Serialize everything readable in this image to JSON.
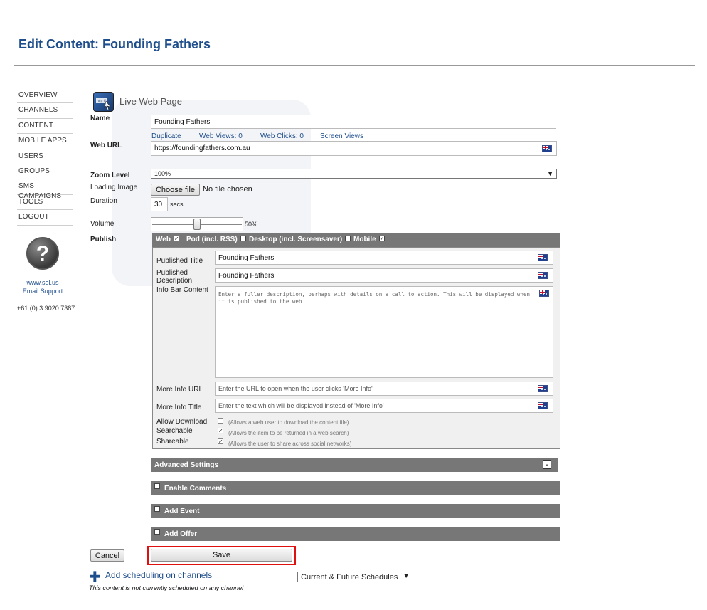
{
  "page": {
    "title": "Edit Content: Founding Fathers"
  },
  "sidebar": {
    "items": [
      {
        "label": "OVERVIEW"
      },
      {
        "label": "CHANNELS"
      },
      {
        "label": "CONTENT"
      },
      {
        "label": "MOBILE APPS"
      },
      {
        "label": "USERS"
      },
      {
        "label": "GROUPS"
      },
      {
        "label": "SMS CAMPAIGNS"
      },
      {
        "label": "TOOLS"
      },
      {
        "label": "LOGOUT"
      }
    ],
    "help_symbol": "?",
    "website": "www.sol.us",
    "email_support": "Email Support",
    "phone": "+61 (0) 3 9020 7387"
  },
  "content_type": {
    "label": "Live Web Page",
    "icon": "live-web-page-icon"
  },
  "form": {
    "name_label": "Name",
    "name_value": "Founding Fathers",
    "links": {
      "duplicate": "Duplicate",
      "web_views": "Web Views: 0",
      "web_clicks": "Web Clicks: 0",
      "screen_views": "Screen Views"
    },
    "web_url_label": "Web URL",
    "web_url_value": "https://foundingfathers.com.au",
    "zoom_label": "Zoom Level",
    "zoom_value": "100%",
    "loading_image_label": "Loading Image",
    "choose_file_button": "Choose file",
    "no_file": "No file chosen",
    "duration_label": "Duration",
    "duration_value": "30",
    "duration_unit": "secs",
    "volume_label": "Volume",
    "volume_value": "50%",
    "volume_level": 0.5,
    "publish_label": "Publish"
  },
  "publish": {
    "options": [
      {
        "label": "Web",
        "checked": true
      },
      {
        "label": "Pod (incl. RSS)",
        "checked": false
      },
      {
        "label": "Desktop (incl. Screensaver)",
        "checked": false
      },
      {
        "label": "Mobile",
        "checked": true
      }
    ],
    "published_title_label": "Published Title",
    "published_title_value": "Founding Fathers",
    "published_description_label": "Published Description",
    "published_description_value": "Founding Fathers",
    "info_bar_label": "Info Bar Content",
    "info_bar_placeholder": "Enter a fuller description, perhaps with details on a call to action. This will be displayed when it is published to the web",
    "more_info_url_label": "More Info URL",
    "more_info_url_placeholder": "Enter the URL to open when the user clicks 'More Info'",
    "more_info_title_label": "More Info Title",
    "more_info_title_placeholder": "Enter the text which will be displayed instead of 'More Info'",
    "allow_download_label": "Allow Download",
    "allow_download_hint": "(Allows a web user to download the content file)",
    "allow_download_checked": false,
    "searchable_label": "Searchable",
    "searchable_hint": "(Allows the item to be returned in a web search)",
    "searchable_checked": true,
    "shareable_label": "Shareable",
    "shareable_hint": "(Allows the user to share across social networks)",
    "shareable_checked": true
  },
  "sections": {
    "advanced": "Advanced Settings",
    "comments": "Enable Comments",
    "event": "Add Event",
    "offer": "Add Offer"
  },
  "actions": {
    "cancel": "Cancel",
    "save": "Save"
  },
  "scheduling": {
    "add_link": "Add scheduling on channels",
    "filter_value": "Current & Future Schedules",
    "note": "This content is not currently scheduled on any channel"
  },
  "colors": {
    "title": "#1f4e8c",
    "bar": "#777777",
    "highlight": "#e01010"
  }
}
